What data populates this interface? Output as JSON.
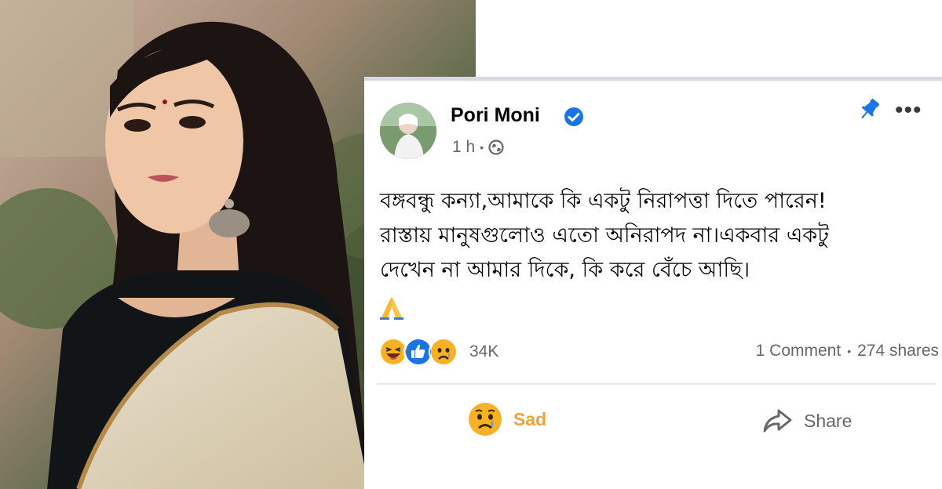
{
  "post": {
    "author": "Pori Moni",
    "time": "1 h",
    "meta_separator": "•",
    "text_lines": [
      "বঙ্গবন্ধু কন্যা,আমাকে কি একটু নিরাপত্তা দিতে পারেন!",
      "রাস্তায় মানুষগুলোও এতো অনিরাপদ না।একবার একটু",
      "দেখেন না আমার দিকে, কি করে বেঁচে আছি।"
    ],
    "emoji": "pray-emoji",
    "reactions": {
      "icons": [
        "haha-icon",
        "like-icon",
        "sad-icon"
      ],
      "count": "34K"
    },
    "comments": "1 Comment",
    "stats_separator": "•",
    "shares": "274 shares",
    "actions": {
      "sad_label": "Sad",
      "share_label": "Share"
    }
  },
  "colors": {
    "verified_blue": "#1b74e4",
    "pin_blue": "#1b74e4",
    "sad_label": "#e7a33e",
    "secondary_text": "#65676b",
    "divider": "#e4e6eb"
  }
}
